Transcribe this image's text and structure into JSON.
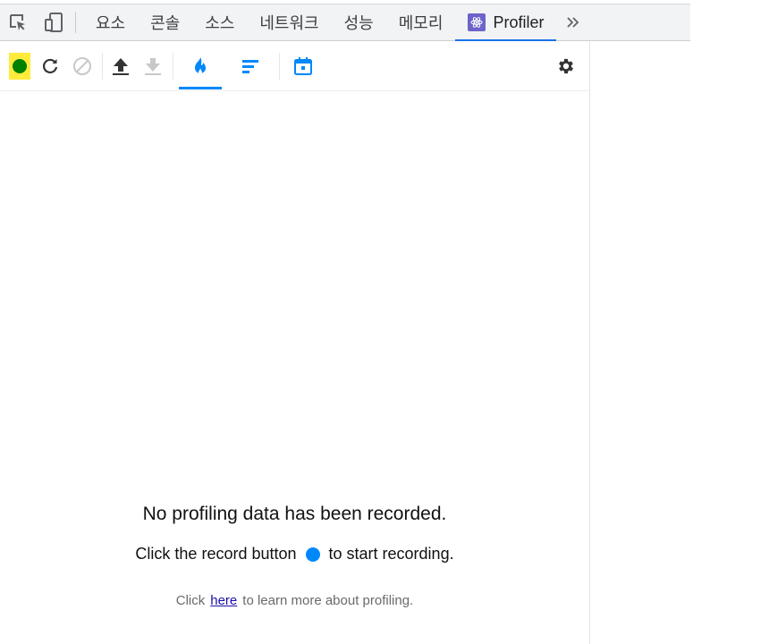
{
  "devtools": {
    "tabs": [
      "요소",
      "콘솔",
      "소스",
      "네트워크",
      "성능",
      "메모리"
    ],
    "active_tab": "Profiler",
    "more_tabs_label": "»"
  },
  "profiler": {
    "toolbar_icons": [
      "record-icon",
      "reload-icon",
      "clear-icon",
      "upload-icon",
      "download-icon",
      "flamegraph-icon",
      "ranked-icon",
      "timeline-icon",
      "gear-icon"
    ],
    "colors": {
      "accent": "#0088fa",
      "record_active": "#008000",
      "highlight": "#ffeb3b"
    },
    "empty_state": {
      "headline": "No profiling data has been recorded.",
      "instruction_before": "Click the record button",
      "instruction_after": "to start recording.",
      "learn_prefix": "Click",
      "learn_link": "here",
      "learn_suffix": "to learn more about profiling."
    }
  }
}
